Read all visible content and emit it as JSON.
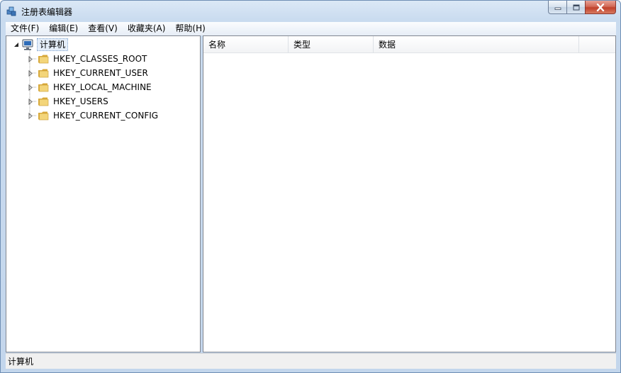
{
  "window": {
    "title": "注册表编辑器"
  },
  "menu": [
    "文件(F)",
    "编辑(E)",
    "查看(V)",
    "收藏夹(A)",
    "帮助(H)"
  ],
  "tree": {
    "root": "计算机",
    "children": [
      "HKEY_CLASSES_ROOT",
      "HKEY_CURRENT_USER",
      "HKEY_LOCAL_MACHINE",
      "HKEY_USERS",
      "HKEY_CURRENT_CONFIG"
    ]
  },
  "list": {
    "columns": [
      "名称",
      "类型",
      "数据"
    ]
  },
  "status": {
    "path": "计算机"
  },
  "colors": {
    "frame": "#c3d6ec",
    "close_button": "#c0402b",
    "folder": "#e8c15a",
    "selection": "#e5eef9"
  },
  "icons": {
    "app": "registry-icon",
    "root": "computer-icon",
    "nodes": "folder-icon"
  }
}
